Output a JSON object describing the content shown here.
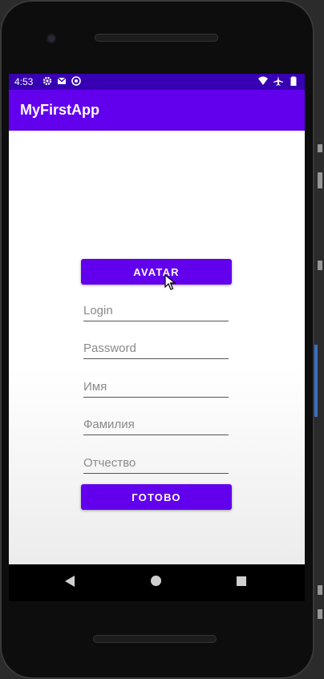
{
  "status_bar": {
    "time": "4:53",
    "left_icons": [
      "gear-icon",
      "mail-icon",
      "sync-icon"
    ],
    "right_icons": [
      "wifi-icon",
      "airplane-icon",
      "battery-icon"
    ]
  },
  "app_bar": {
    "title": "MyFirstApp"
  },
  "form": {
    "avatar_button": "AVATAR",
    "login_placeholder": "Login",
    "password_placeholder": "Password",
    "first_name_placeholder": "Имя",
    "last_name_placeholder": "Фамилия",
    "patronymic_placeholder": "Отчество",
    "done_button": "ГОТОВО"
  },
  "colors": {
    "status_bar": "#3700b3",
    "primary": "#6200ee"
  }
}
